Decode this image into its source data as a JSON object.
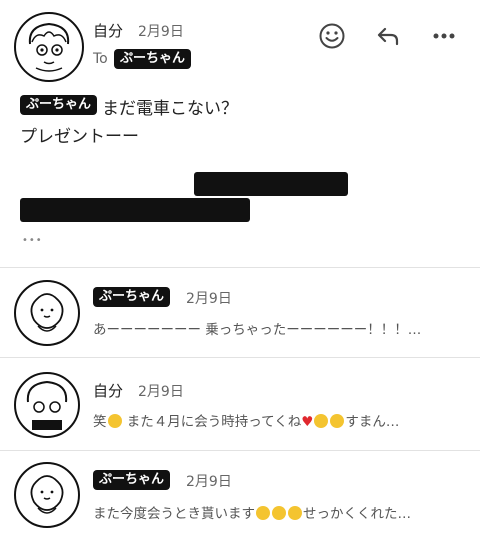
{
  "thread": {
    "first": {
      "sender": "自分",
      "date": "2月9日",
      "to_prefix": "To",
      "recipient_tag": "ぷーちゃん",
      "body_tag": "ぷーちゃん",
      "body_line1": "まだ電車こない？",
      "body_line2": "プレゼントーー",
      "more_dots": "•••"
    },
    "toolbar": {
      "emoji_icon": "smiley-icon",
      "reply_icon": "reply-arrow-icon",
      "more_icon": "more-dots-icon"
    },
    "messages": [
      {
        "sender_tag": "ぷーちゃん",
        "date": "2月9日",
        "preview": "あーーーーーーー 乗っちゃったーーーーーー！！！…"
      },
      {
        "sender": "自分",
        "date": "2月9日",
        "preview_a": "笑",
        "preview_b": " また４月に会う時持ってくね",
        "preview_c": "すまん…"
      },
      {
        "sender_tag": "ぷーちゃん",
        "date": "2月9日",
        "preview_a": "また今度会うとき貰います",
        "preview_b": "せっかくくれた…"
      }
    ]
  }
}
